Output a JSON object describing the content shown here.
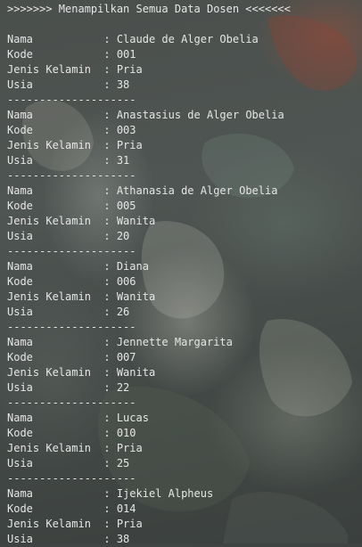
{
  "header": ">>>>>>> Menampilkan Semua Data Dosen <<<<<<<",
  "labels": {
    "nama": "Nama           : ",
    "kode": "Kode           : ",
    "gender": "Jenis Kelamin  : ",
    "usia": "Usia           : "
  },
  "separator": "--------------------",
  "records": [
    {
      "nama": "Claude de Alger Obelia",
      "kode": "001",
      "gender": "Pria",
      "usia": "38"
    },
    {
      "nama": "Anastasius de Alger Obelia",
      "kode": "003",
      "gender": "Pria",
      "usia": "31"
    },
    {
      "nama": "Athanasia de Alger Obelia",
      "kode": "005",
      "gender": "Wanita",
      "usia": "20"
    },
    {
      "nama": "Diana",
      "kode": "006",
      "gender": "Wanita",
      "usia": "26"
    },
    {
      "nama": "Jennette Margarita",
      "kode": "007",
      "gender": "Wanita",
      "usia": "22"
    },
    {
      "nama": "Lucas",
      "kode": "010",
      "gender": "Pria",
      "usia": "25"
    },
    {
      "nama": "Ijekiel Alpheus",
      "kode": "014",
      "gender": "Pria",
      "usia": "38"
    }
  ]
}
